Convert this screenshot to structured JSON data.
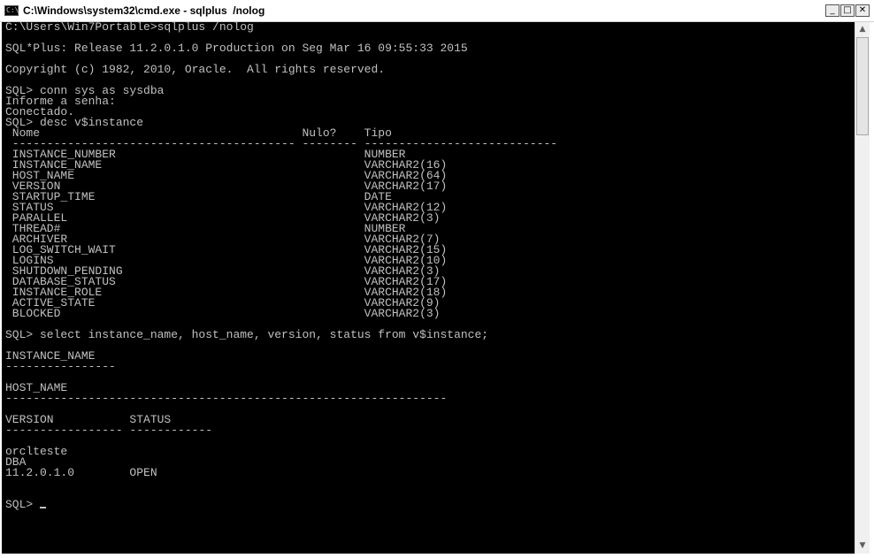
{
  "window": {
    "title": "C:\\Windows\\system32\\cmd.exe - sqlplus  /nolog",
    "icon_label": "C:\\",
    "controls": {
      "minimize": "_",
      "maximize": "□",
      "close": "✕"
    }
  },
  "console": {
    "lines": [
      "C:\\Users\\Win7Portable>sqlplus /nolog",
      "",
      "SQL*Plus: Release 11.2.0.1.0 Production on Seg Mar 16 09:55:33 2015",
      "",
      "Copyright (c) 1982, 2010, Oracle.  All rights reserved.",
      "",
      "SQL> conn sys as sysdba",
      "Informe a senha:",
      "Conectado.",
      "SQL> desc v$instance",
      " Nome                                      Nulo?    Tipo",
      " ----------------------------------------- -------- ----------------------------",
      " INSTANCE_NUMBER                                    NUMBER",
      " INSTANCE_NAME                                      VARCHAR2(16)",
      " HOST_NAME                                          VARCHAR2(64)",
      " VERSION                                            VARCHAR2(17)",
      " STARTUP_TIME                                       DATE",
      " STATUS                                             VARCHAR2(12)",
      " PARALLEL                                           VARCHAR2(3)",
      " THREAD#                                            NUMBER",
      " ARCHIVER                                           VARCHAR2(7)",
      " LOG_SWITCH_WAIT                                    VARCHAR2(15)",
      " LOGINS                                             VARCHAR2(10)",
      " SHUTDOWN_PENDING                                   VARCHAR2(3)",
      " DATABASE_STATUS                                    VARCHAR2(17)",
      " INSTANCE_ROLE                                      VARCHAR2(18)",
      " ACTIVE_STATE                                       VARCHAR2(9)",
      " BLOCKED                                            VARCHAR2(3)",
      "",
      "SQL> select instance_name, host_name, version, status from v$instance;",
      "",
      "INSTANCE_NAME",
      "----------------",
      "",
      "HOST_NAME",
      "----------------------------------------------------------------",
      "",
      "VERSION           STATUS",
      "----------------- ------------",
      "",
      "orclteste",
      "DBA",
      "11.2.0.1.0        OPEN",
      "",
      "",
      "SQL> "
    ]
  },
  "scrollbar": {
    "up_arrow": "▲",
    "down_arrow": "▼",
    "position_fraction": 0.0
  }
}
